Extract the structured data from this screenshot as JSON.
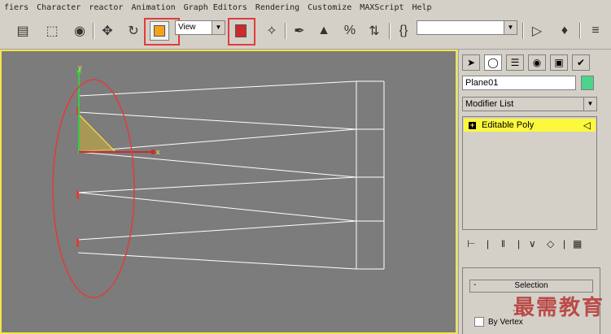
{
  "menu": {
    "items": [
      "fiers",
      "Character",
      "reactor",
      "Animation",
      "Graph Editors",
      "Rendering",
      "Customize",
      "MAXScript",
      "Help"
    ]
  },
  "toolbar": {
    "view_dropdown": "View",
    "named_selection": ""
  },
  "viewport": {
    "axis_y": "y",
    "axis_x": "x"
  },
  "command_panel": {
    "object_name": "Plane01",
    "object_color": "#4bd48a",
    "modifier_list": "Modifier List",
    "stack_items": [
      {
        "label": "Editable Poly"
      }
    ],
    "rollout_title": "Selection",
    "by_vertex_label": "By Vertex"
  },
  "watermark": "最需教育",
  "colors": {
    "viewport_border": "#f2e64a",
    "selected_stack": "#fcf93c",
    "annotation": "#e23b3b"
  }
}
